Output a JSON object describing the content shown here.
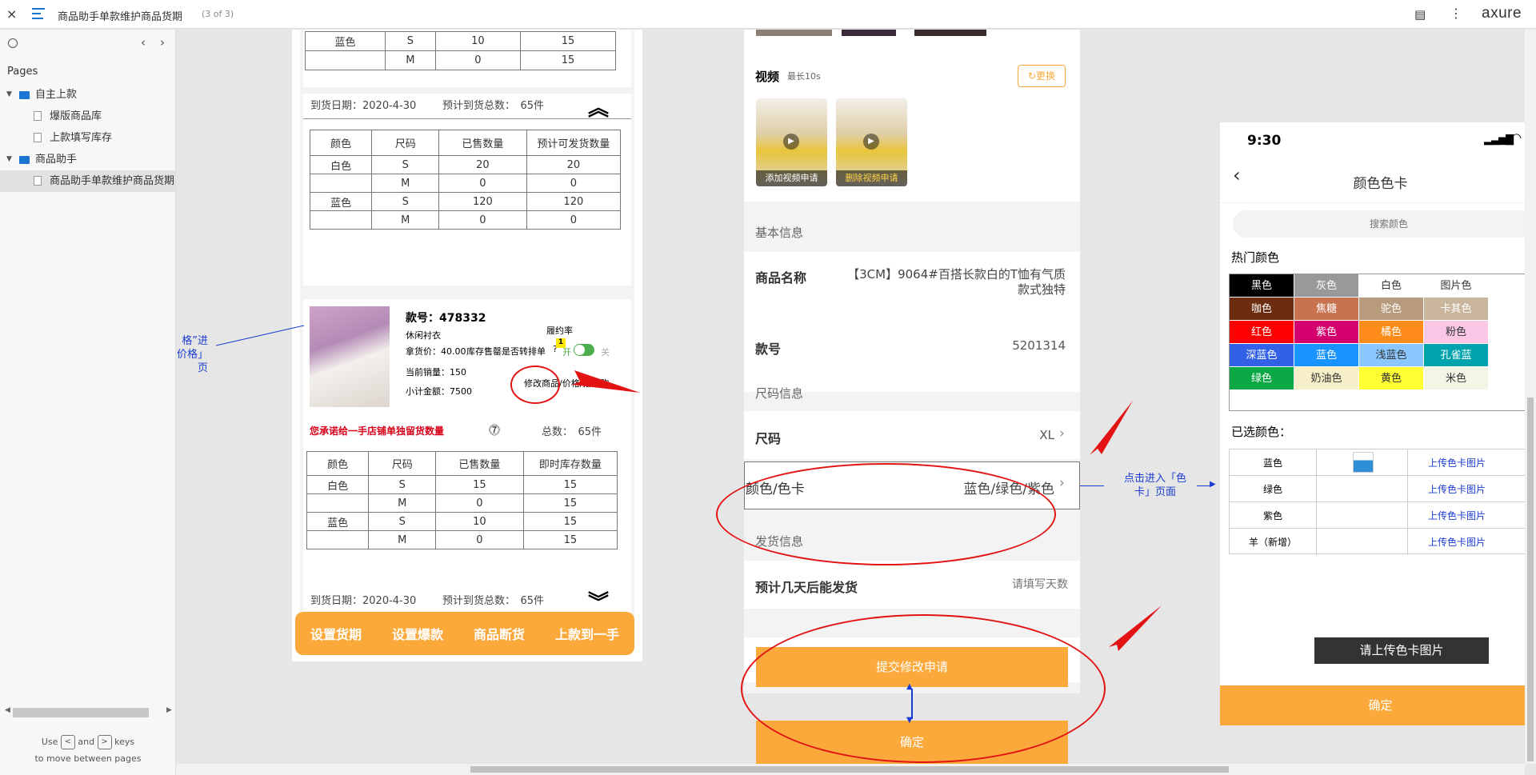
{
  "topbar": {
    "close": "×",
    "title": "商品助手单款维护商品货期",
    "count": "(3 of 3)",
    "brand": "axure"
  },
  "sidebar": {
    "pages_label": "Pages",
    "tree": [
      {
        "label": "自主上款",
        "type": "folder",
        "level": 0
      },
      {
        "label": "爆版商品库",
        "type": "page",
        "level": 1
      },
      {
        "label": "上款填写库存",
        "type": "page",
        "level": 1
      },
      {
        "label": "商品助手",
        "type": "folder",
        "level": 0
      },
      {
        "label": "商品助手单款维护商品货期",
        "type": "page",
        "level": 1,
        "selected": true
      }
    ],
    "hint_use": "Use",
    "hint_and": "and",
    "hint_keys": "keys",
    "hint_line2": "to move between pages"
  },
  "left": {
    "table1": [
      [
        "蓝色",
        "S",
        "10",
        "15"
      ],
      [
        "",
        "M",
        "0",
        "15"
      ]
    ],
    "delivery1": {
      "date": "到货日期：2020-4-30",
      "total": "预计到货总数：　65件"
    },
    "table2_head": [
      "颜色",
      "尺码",
      "已售数量",
      "预计可发货数量"
    ],
    "table2": [
      [
        "白色",
        "S",
        "20",
        "20"
      ],
      [
        "",
        "M",
        "0",
        "0"
      ],
      [
        "蓝色",
        "S",
        "120",
        "120"
      ],
      [
        "",
        "M",
        "0",
        "0"
      ]
    ],
    "product": {
      "style_no": "款号：478332",
      "category": "休闲衬衣",
      "price": "拿货价：40.00",
      "stock_label": "库存售罄是否转排单",
      "badge": "1",
      "perf": "履约率",
      "on": "开",
      "off": "关",
      "sales": "当前销量：150",
      "subtotal": "小计金额：7500",
      "edit_link": "修改商品/价格/搭配购"
    },
    "promise": {
      "text": "您承诺给一手店铺单独留货数量",
      "total": "总数：　65件"
    },
    "table3_head": [
      "颜色",
      "尺码",
      "已售数量",
      "即时库存数量"
    ],
    "table3": [
      [
        "白色",
        "S",
        "15",
        "15"
      ],
      [
        "",
        "M",
        "0",
        "15"
      ],
      [
        "蓝色",
        "S",
        "10",
        "15"
      ],
      [
        "",
        "M",
        "0",
        "15"
      ]
    ],
    "delivery2": {
      "date": "到货日期：2020-4-30",
      "total": "预计到货总数：　65件"
    },
    "actions": [
      "设置货期",
      "设置爆款",
      "商品断货",
      "上款到一手"
    ],
    "note_lines": [
      "格”进",
      "价格」",
      "页"
    ]
  },
  "middle": {
    "video_label": "视频",
    "video_sub": "最长10s",
    "replace": "更换",
    "thumb1": "添加视频申请",
    "thumb2": "删除视频申请",
    "basic_header": "基本信息",
    "name_label": "商品名称",
    "name_value": "【3CM】9064#百搭长款白的T恤有气质款式独特",
    "style_label": "款号",
    "style_value": "5201314",
    "size_header": "尺码信息",
    "size_label": "尺码",
    "size_value": "XL",
    "color_label": "颜色/色卡",
    "color_value": "蓝色/绿色/紫色",
    "ship_header": "发货信息",
    "ship_label": "预计几天后能发货",
    "ship_placeholder": "请填写天数",
    "submit": "提交修改申请",
    "confirm": "确定",
    "note": [
      "点击进入「色",
      "卡」页面"
    ]
  },
  "right": {
    "time": "9:30",
    "title": "颜色色卡",
    "search_placeholder": "搜索颜色",
    "hot_label": "热门颜色",
    "swatches": [
      [
        {
          "n": "黑色",
          "bg": "#000000",
          "fg": "#ffffff"
        },
        {
          "n": "灰色",
          "bg": "#999999",
          "fg": "#ffffff"
        },
        {
          "n": "白色",
          "bg": "#ffffff",
          "fg": "#333333"
        },
        {
          "n": "图片色",
          "bg": "#ffffff",
          "fg": "#333333"
        }
      ],
      [
        {
          "n": "咖色",
          "bg": "#6b2c0f",
          "fg": "#ffffff"
        },
        {
          "n": "焦糖",
          "bg": "#c87250",
          "fg": "#ffffff"
        },
        {
          "n": "驼色",
          "bg": "#b89a7c",
          "fg": "#ffffff"
        },
        {
          "n": "卡其色",
          "bg": "#c8b59c",
          "fg": "#ffffff"
        }
      ],
      [
        {
          "n": "红色",
          "bg": "#ff0000",
          "fg": "#ffffff"
        },
        {
          "n": "紫色",
          "bg": "#d4006e",
          "fg": "#ffffff"
        },
        {
          "n": "橘色",
          "bg": "#ff8c1a",
          "fg": "#ffffff"
        },
        {
          "n": "粉色",
          "bg": "#fac7e6",
          "fg": "#333333"
        }
      ],
      [
        {
          "n": "深蓝色",
          "bg": "#3361e6",
          "fg": "#ffffff"
        },
        {
          "n": "蓝色",
          "bg": "#1993ff",
          "fg": "#ffffff"
        },
        {
          "n": "浅蓝色",
          "bg": "#8ac6ff",
          "fg": "#333333"
        },
        {
          "n": "孔雀蓝",
          "bg": "#00a3ad",
          "fg": "#ffffff"
        }
      ],
      [
        {
          "n": "绿色",
          "bg": "#0aa845",
          "fg": "#ffffff"
        },
        {
          "n": "奶油色",
          "bg": "#f7efc8",
          "fg": "#333333"
        },
        {
          "n": "黄色",
          "bg": "#ffff33",
          "fg": "#333333"
        },
        {
          "n": "米色",
          "bg": "#f5f5e6",
          "fg": "#333333"
        }
      ]
    ],
    "selected_label": "已选颜色：",
    "selected": [
      {
        "name": "蓝色",
        "upload": "上传色卡图片",
        "has_img": true
      },
      {
        "name": "绿色",
        "upload": "上传色卡图片",
        "has_img": false
      },
      {
        "name": "紫色",
        "upload": "上传色卡图片",
        "has_img": false
      },
      {
        "name": "羊（新增）",
        "upload": "上传色卡图片",
        "has_img": false
      }
    ],
    "upload_btn": "请上传色卡图片",
    "confirm": "确定"
  },
  "colors": {
    "accent": "#fca93c",
    "annotation": "#1a3bd1",
    "highlight": "#e31313"
  }
}
